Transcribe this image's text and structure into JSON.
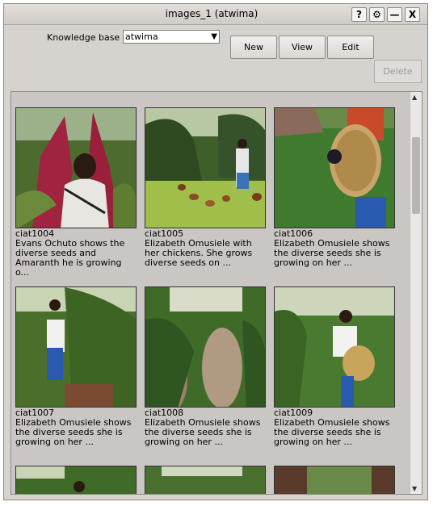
{
  "window": {
    "title": "images_1 (atwima)",
    "help_label": "?",
    "settings_icon": "gear-icon",
    "minimize_label": "—",
    "close_label": "X"
  },
  "knowledge_base": {
    "label": "Knowledge base",
    "value": "atwima"
  },
  "toolbar": {
    "new_label": "New",
    "view_label": "View",
    "edit_label": "Edit",
    "delete_label": "Delete"
  },
  "images": [
    {
      "id": "ciat1004",
      "caption": "Evans Ochuto shows the diverse seeds and Amaranth he is growing o..."
    },
    {
      "id": "ciat1005",
      "caption": "Elizabeth Omusiele with her chickens. She grows diverse seeds on ..."
    },
    {
      "id": "ciat1006",
      "caption": "Elizabeth Omusiele shows the diverse seeds she is growing on her ..."
    },
    {
      "id": "ciat1007",
      "caption": "Elizabeth Omusiele shows the diverse seeds she is growing on her ..."
    },
    {
      "id": "ciat1008",
      "caption": "Elizabeth Omusiele shows the diverse seeds she is growing on her ..."
    },
    {
      "id": "ciat1009",
      "caption": "Elizabeth Omusiele shows the diverse seeds she is growing on her ..."
    }
  ]
}
